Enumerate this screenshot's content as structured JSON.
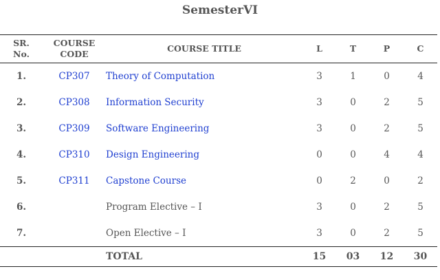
{
  "title": "SemesterVI",
  "table": {
    "headers": {
      "sr_line1": "SR.",
      "sr_line2": "No.",
      "code_line1": "COURSE",
      "code_line2": "CODE",
      "course_title": "COURSE TITLE",
      "l": "L",
      "t": "T",
      "p": "P",
      "c": "C"
    },
    "rows": [
      {
        "sr": "1.",
        "code": "CP307",
        "title": "Theory of Computation",
        "l": "3",
        "t": "1",
        "p": "0",
        "c": "4"
      },
      {
        "sr": "2.",
        "code": "CP308",
        "title": "Information Security",
        "l": "3",
        "t": "0",
        "p": "2",
        "c": "5"
      },
      {
        "sr": "3.",
        "code": "CP309",
        "title": "Software Engineering",
        "l": "3",
        "t": "0",
        "p": "2",
        "c": "5"
      },
      {
        "sr": "4.",
        "code": "CP310",
        "title": "Design Engineering",
        "l": "0",
        "t": "0",
        "p": "4",
        "c": "4"
      },
      {
        "sr": "5.",
        "code": "CP311",
        "title": "Capstone Course",
        "l": "0",
        "t": "2",
        "p": "0",
        "c": "2"
      },
      {
        "sr": "6.",
        "code": "",
        "title": "Program Elective – I",
        "l": "3",
        "t": "0",
        "p": "2",
        "c": "5"
      },
      {
        "sr": "7.",
        "code": "",
        "title": "Open Elective – I",
        "l": "3",
        "t": "0",
        "p": "2",
        "c": "5"
      }
    ],
    "total": {
      "label": "TOTAL",
      "l": "15",
      "t": "03",
      "p": "12",
      "c": "30"
    }
  },
  "colors": {
    "link": "#1f3fd0",
    "text": "#555555",
    "rule": "#222222"
  }
}
